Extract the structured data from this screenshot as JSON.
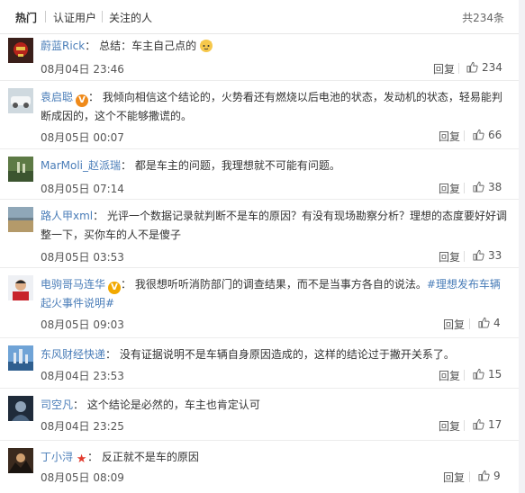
{
  "tabs": [
    {
      "label": "热门"
    },
    {
      "label": "认证用户"
    },
    {
      "label": "关注的人"
    }
  ],
  "total_label": "共234条",
  "comments": [
    {
      "user": "蔚蓝Rick",
      "colon": "：",
      "text": "总结：车主自己点的",
      "time": "08月04日 23:46",
      "reply": "回复",
      "likes": "234"
    },
    {
      "user": "袁启聪",
      "colon": "：",
      "text": "我倾向相信这个结论的，火势看还有燃烧以后电池的状态，发动机的状态，轻易能判断成因的，这个不能够撒谎的。",
      "time": "08月05日 00:07",
      "reply": "回复",
      "likes": "66"
    },
    {
      "user": "MarMoli_赵派瑞",
      "colon": "：",
      "text": "都是车主的问题，我理想就不可能有问题。",
      "time": "08月05日 07:14",
      "reply": "回复",
      "likes": "38"
    },
    {
      "user": "路人甲xml",
      "colon": "：",
      "text": "光评一个数据记录就判断不是车的原因？有没有现场勘察分析？理想的态度要好好调整一下，买你车的人不是傻子",
      "time": "08月05日 03:53",
      "reply": "回复",
      "likes": "33"
    },
    {
      "user": "电驹哥马连华",
      "colon": "：",
      "text": "我很想听听消防部门的调查结果，而不是当事方各自的说法。",
      "hashtag": "#理想发布车辆起火事件说明#",
      "time": "08月05日 09:03",
      "reply": "回复",
      "likes": "4"
    },
    {
      "user": "东风财经快递",
      "colon": "：",
      "text": "没有证据说明不是车辆自身原因造成的，这样的结论过于撇开关系了。",
      "time": "08月04日 23:53",
      "reply": "回复",
      "likes": "15"
    },
    {
      "user": "司空凡",
      "colon": "：",
      "text": "这个结论是必然的，车主也肯定认可",
      "time": "08月04日 23:25",
      "reply": "回复",
      "likes": "17"
    },
    {
      "user": "丁小浔",
      "colon": "：",
      "text": "反正就不是车的原因",
      "time": "08月05日 08:09",
      "reply": "回复",
      "likes": "9"
    }
  ],
  "icons": {
    "like": "thumbs-up-icon",
    "verified_orange": "verified-orange-icon",
    "verified_gold": "verified-gold-icon",
    "star": "red-star-icon",
    "emoji": "cat-face-emoji-icon"
  },
  "colors": {
    "link": "#4a7db8",
    "text": "#333333",
    "meta": "#555555"
  }
}
